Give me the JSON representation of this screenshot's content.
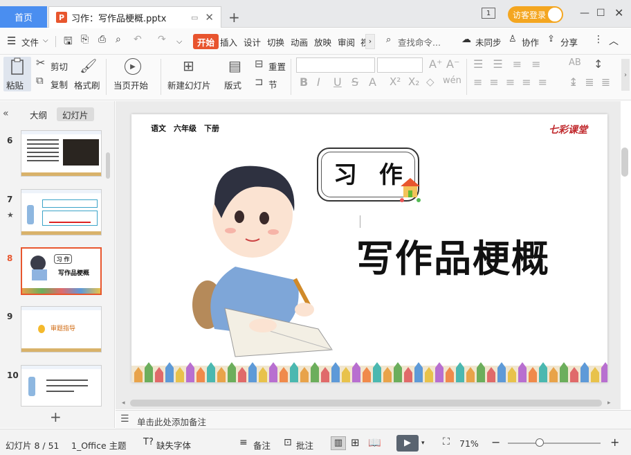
{
  "titlebar": {
    "home_tab": "首页",
    "doc_icon": "P",
    "doc_title": "习作：写作品梗概.pptx",
    "login_label": "访客登录",
    "window_num": "1"
  },
  "menubar": {
    "file": "文件",
    "items": [
      "开始",
      "插入",
      "设计",
      "切换",
      "动画",
      "放映",
      "审阅",
      "视"
    ],
    "search_placeholder": "查找命令...",
    "sync": "未同步",
    "collab": "协作",
    "share": "分享"
  },
  "ribbon": {
    "paste": "粘贴",
    "cut": "剪切",
    "copy": "复制",
    "format_painter": "格式刷",
    "from_current": "当页开始",
    "new_slide": "新建幻灯片",
    "layout": "版式",
    "reset": "重置",
    "section": "节"
  },
  "leftpanel": {
    "outline_tab": "大纲",
    "slides_tab": "幻灯片",
    "thumbs": [
      {
        "num": "6"
      },
      {
        "num": "7"
      },
      {
        "num": "8",
        "title": "写作品梗概",
        "badge": "习 作"
      },
      {
        "num": "9",
        "title": "审题指导"
      },
      {
        "num": "10"
      }
    ],
    "add_label": "+"
  },
  "slide": {
    "header": "语文　六年级　下册",
    "brand": "七彩课堂",
    "badge": "习 作",
    "title": "写作品梗概"
  },
  "notes": {
    "placeholder": "单击此处添加备注"
  },
  "status": {
    "slide_info": "幻灯片 8 / 51",
    "theme": "1_Office 主题",
    "missing_font": "缺失字体",
    "notes_btn": "备注",
    "comment_btn": "批注",
    "zoom": "71%"
  }
}
